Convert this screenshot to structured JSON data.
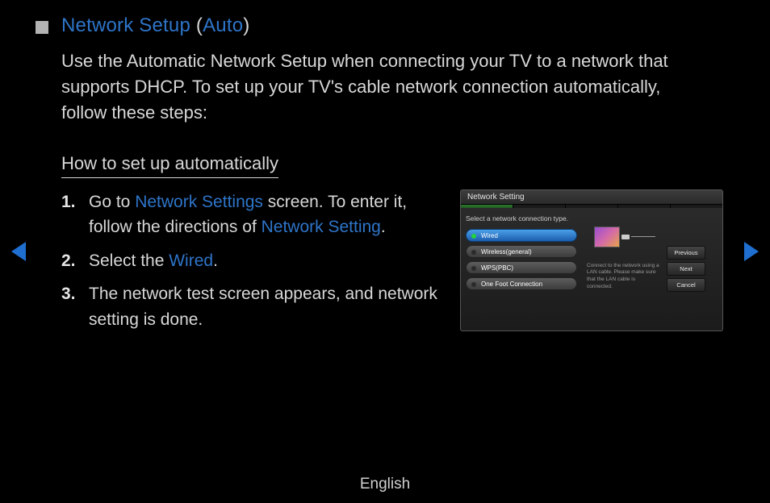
{
  "title": {
    "prefix": "Network Setup",
    "paren_open": " (",
    "suffix": "Auto",
    "paren_close": ")"
  },
  "intro": "Use the Automatic Network Setup when connecting your TV to a network that supports DHCP. To set up your TV's cable network connection automatically, follow these steps:",
  "subhead": "How to set up automatically",
  "steps": [
    {
      "num": "1.",
      "a": "Go to ",
      "hl1": "Network Settings",
      "b": " screen. To enter it, follow the directions of ",
      "hl2": "Network Setting",
      "c": "."
    },
    {
      "num": "2.",
      "a": "Select the ",
      "hl1": "Wired",
      "b": ".",
      "hl2": "",
      "c": ""
    },
    {
      "num": "3.",
      "a": "The network test screen appears, and network setting is done.",
      "hl1": "",
      "b": "",
      "hl2": "",
      "c": ""
    }
  ],
  "panel": {
    "title": "Network Setting",
    "prompt": "Select a network connection type.",
    "items": [
      "Wired",
      "Wireless(general)",
      "WPS(PBC)",
      "One Foot Connection"
    ],
    "help": "Connect to the network using a LAN cable. Please make sure that the LAN cable is connected.",
    "buttons": [
      "Previous",
      "Next",
      "Cancel"
    ]
  },
  "footer": "English"
}
